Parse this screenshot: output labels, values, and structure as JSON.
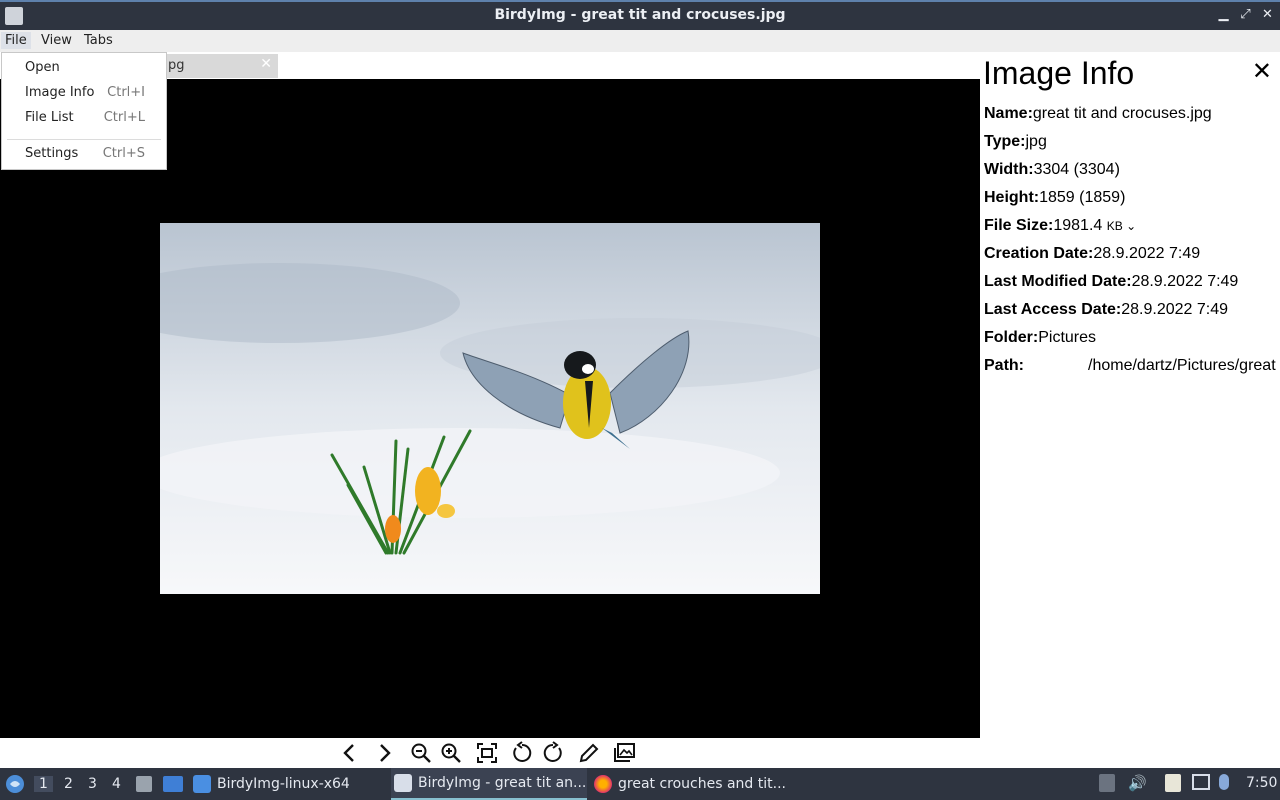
{
  "window": {
    "title": "BirdyImg - great tit and crocuses.jpg"
  },
  "menubar": {
    "items": [
      "File",
      "View",
      "Tabs"
    ]
  },
  "file_menu": {
    "items": [
      {
        "label": "Open",
        "shortcut": ""
      },
      {
        "label": "Image Info",
        "shortcut": "Ctrl+I"
      },
      {
        "label": "File List",
        "shortcut": "Ctrl+L"
      },
      {
        "label": "Settings",
        "shortcut": "Ctrl+S"
      }
    ]
  },
  "tab": {
    "label_visible": "pg"
  },
  "image_info": {
    "title": "Image Info",
    "rows": [
      {
        "label": "Name:",
        "value": "great tit and crocuses.jpg"
      },
      {
        "label": "Type:",
        "value": "jpg"
      },
      {
        "label": "Width:",
        "value": "3304 (3304)"
      },
      {
        "label": "Height:",
        "value": "1859 (1859)"
      },
      {
        "label": "File Size:",
        "value": "1981.4",
        "unit": "KB"
      },
      {
        "label": "Creation Date:",
        "value": "28.9.2022 7:49"
      },
      {
        "label": "Last Modified Date:",
        "value": "28.9.2022 7:49"
      },
      {
        "label": "Last Access Date:",
        "value": "28.9.2022 7:49"
      },
      {
        "label": "Folder:",
        "value": "Pictures"
      },
      {
        "label": "Path:",
        "value": "/home/dartz/Pictures/great"
      }
    ]
  },
  "toolbar": {
    "icons": [
      "previous-icon",
      "next-icon",
      "zoom-out-icon",
      "zoom-in-icon",
      "fit-to-window-icon",
      "rotate-left-icon",
      "rotate-right-icon",
      "edit-icon",
      "gallery-icon"
    ]
  },
  "taskbar": {
    "workspaces": [
      "1",
      "2",
      "3",
      "4"
    ],
    "tasks": [
      {
        "label": "BirdyImg-linux-x64"
      },
      {
        "label": "BirdyImg - great tit an..."
      },
      {
        "label": "great crouches and tit..."
      }
    ],
    "clock": "7:50"
  },
  "colors": {
    "titlebar": "#2e3440",
    "accent": "#5e81ac",
    "panel": "#ffffff",
    "viewer": "#000000"
  }
}
